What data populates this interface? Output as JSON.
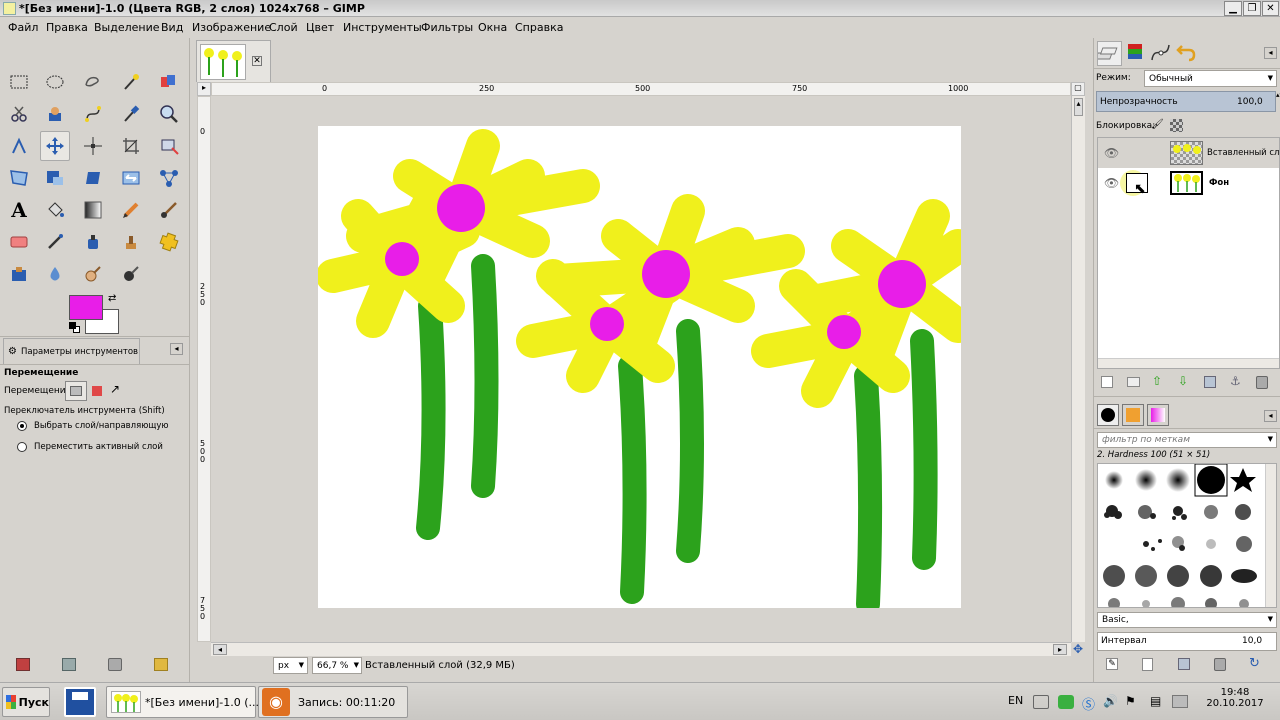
{
  "window": {
    "title": "*[Без имени]-1.0 (Цвета RGB, 2 слоя) 1024x768 – GIMP"
  },
  "menu": [
    "Файл",
    "Правка",
    "Выделение",
    "Вид",
    "Изображение",
    "Слой",
    "Цвет",
    "Инструменты",
    "Фильтры",
    "Окна",
    "Справка"
  ],
  "rulers": {
    "top_ticks": [
      "0",
      "250",
      "500",
      "750",
      "1000"
    ],
    "left_ticks": [
      "0",
      "250",
      "500",
      "750"
    ]
  },
  "tool_options": {
    "tab_label": "Параметры инструментов",
    "title": "Перемещение",
    "move_label": "Перемещение:",
    "switch_label": "Переключатель инструмента  (Shift)",
    "radio1": "Выбрать слой/направляющую",
    "radio2": "Переместить активный слой"
  },
  "colors": {
    "foreground": "#e81ee8",
    "background": "#ffffff",
    "petal": "#f0f01c",
    "stem": "#2ca21c",
    "center": "#e81ee8"
  },
  "status": {
    "unit": "px",
    "zoom": "66,7 %",
    "text": "Вставленный слой (32,9 МБ)"
  },
  "layers": {
    "mode_label": "Режим:",
    "mode_value": "Обычный",
    "opacity_label": "Непрозрачность",
    "opacity_value": "100,0",
    "lock_label": "Блокировка:",
    "items": [
      {
        "name": "Вставленный сло"
      },
      {
        "name": "Фон"
      }
    ]
  },
  "brushes": {
    "filter_placeholder": "фильтр по меткам",
    "selected_brush": "2. Hardness 100 (51 × 51)",
    "preset": "Basic,",
    "spacing_label": "Интервал",
    "spacing_value": "10,0"
  },
  "taskbar": {
    "start": "Пуск",
    "gimp_task": "*[Без имени]-1.0 (...",
    "record_task": "Запись:  00:11:20",
    "lang": "EN",
    "time": "19:48",
    "date": "20.10.2017"
  }
}
